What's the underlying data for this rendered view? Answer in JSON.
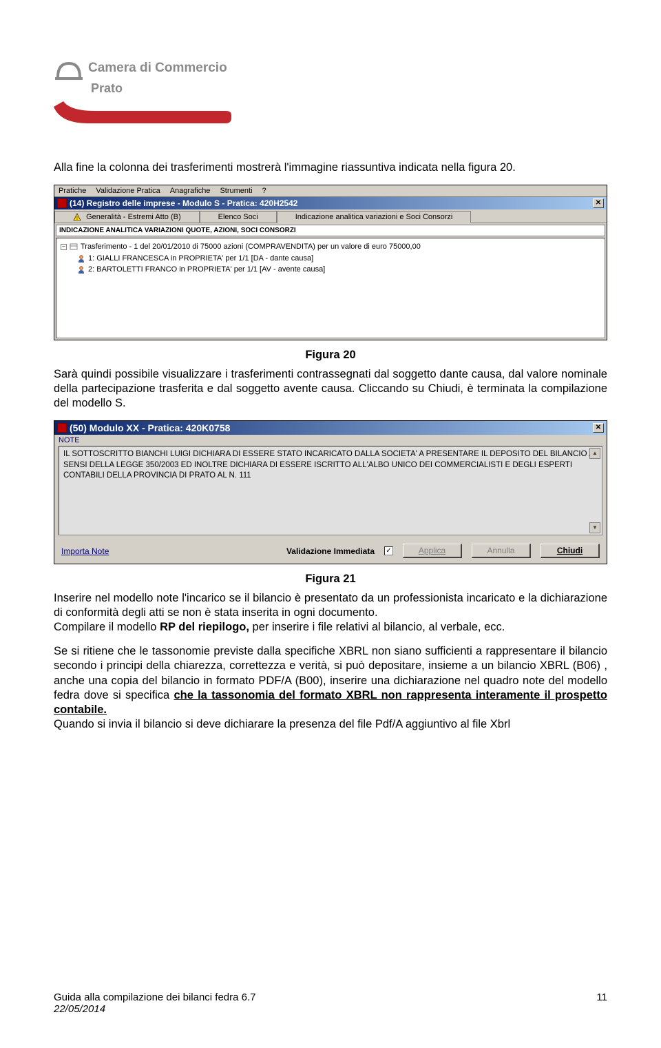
{
  "logo": {
    "line1": "Camera di Commercio",
    "line2": "Prato"
  },
  "intro": "Alla fine la colonna dei trasferimenti mostrerà l'immagine riassuntiva indicata  nella figura 20.",
  "fig20": {
    "menubar": [
      "Pratiche",
      "Validazione Pratica",
      "Anagrafiche",
      "Strumenti",
      "?"
    ],
    "title": "(14) Registro delle imprese - Modulo S - Pratica: 420H2542",
    "tabs": {
      "t1": "Generalità - Estremi Atto (B)",
      "t2": "Elenco Soci",
      "t3": "Indicazione analitica variazioni e Soci Consorzi"
    },
    "section": "INDICAZIONE ANALITICA VARIAZIONI QUOTE, AZIONI, SOCI CONSORZI",
    "tree": {
      "root": "Trasferimento - 1 del 20/01/2010 di 75000 azioni (COMPRAVENDITA) per un valore di euro 75000,00",
      "c1": "1: GIALLI FRANCESCA in PROPRIETA' per 1/1 [DA - dante causa]",
      "c2": "2: BARTOLETTI FRANCO in PROPRIETA' per 1/1 [AV - avente causa]"
    },
    "caption": "Figura 20"
  },
  "para2": "Sarà quindi possibile visualizzare i trasferimenti contrassegnati dal soggetto dante causa, dal valore nominale della partecipazione trasferita e dal soggetto avente causa. Cliccando su Chiudi, è terminata la compilazione del modello S.",
  "fig21": {
    "title": "(50) Modulo XX - Pratica: 420K0758",
    "noteLabel": "NOTE",
    "noteText": "IL SOTTOSCRITTO BIANCHI LUIGI DICHIARA DI ESSERE STATO  INCARICATO DALLA SOCIETA' A PRESENTARE IL DEPOSITO DEL BILANCIO AI SENSI DELLA LEGGE 350/2003 ED INOLTRE DICHIARA DI ESSERE ISCRITTO ALL'ALBO UNICO DEI COMMERCIALISTI E DEGLI ESPERTI CONTABILI DELLA PROVINCIA DI PRATO AL N. 111",
    "link": "Importa Note",
    "valLabel": "Validazione Immediata",
    "checked": "✓",
    "btnApplica": "Applica",
    "btnAnnulla": "Annulla",
    "btnChiudi": "Chiudi",
    "caption": "Figura 21"
  },
  "para3a": "Inserire nel modello note l'incarico se il bilancio è presentato da un  professionista incaricato e la dichiarazione di conformità degli atti se non è stata inserita in ogni documento.",
  "para3b_pre": "Compilare il modello ",
  "para3b_bold": "RP del riepilogo,",
  "para3b_post": " per inserire i file relativi al bilancio, al verbale, ecc.",
  "para4a": "Se si ritiene che le tassonomie previste dalla specifiche XBRL non siano sufficienti a rappresentare il bilancio secondo i principi della chiarezza, correttezza e verità, si può depositare, insieme a un bilancio XBRL (B06) , anche una copia del bilancio in formato PDF/A (B00),  inserire una dichiarazione nel quadro note del modello fedra dove si specifica ",
  "para4b_under": "che la tassonomia del formato XBRL non rappresenta interamente il prospetto contabile.",
  "para5": "Quando si invia il bilancio si deve dichiarare la presenza del file Pdf/A aggiuntivo al file Xbrl",
  "footer": {
    "left1": "Guida alla compilazione dei bilanci fedra 6.7",
    "left2": "22/05/2014",
    "right": "11"
  }
}
